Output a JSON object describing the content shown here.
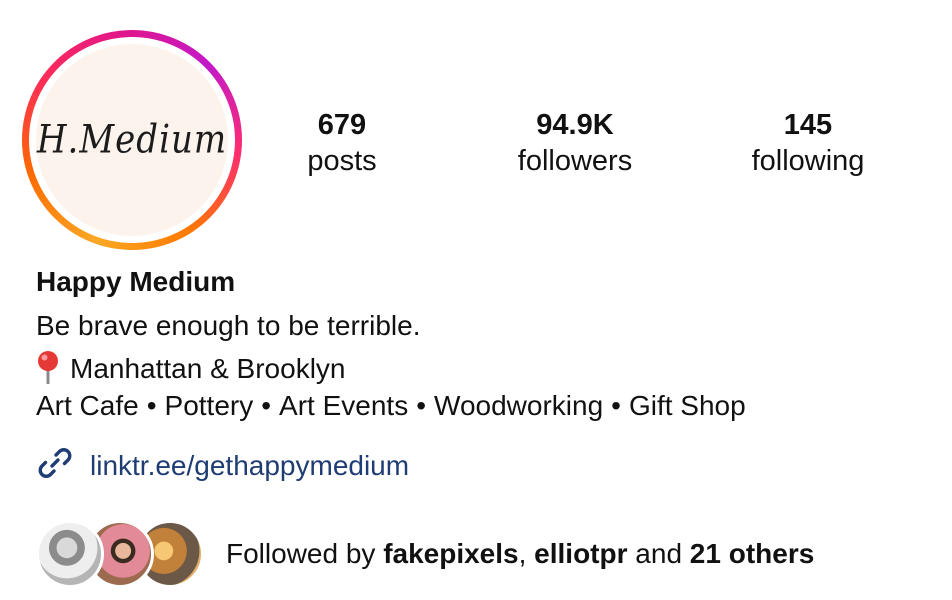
{
  "profile": {
    "logo_text": "H.Medium",
    "name": "Happy Medium",
    "stats": [
      {
        "value": "679",
        "label": "posts"
      },
      {
        "value": "94.9K",
        "label": "followers"
      },
      {
        "value": "145",
        "label": "following"
      }
    ],
    "bio": {
      "line1": "Be brave enough to be terrible.",
      "location": "Manhattan & Brooklyn",
      "categories": [
        "Art Cafe",
        "Pottery",
        "Art Events",
        "Woodworking",
        "Gift Shop"
      ],
      "separator": "•"
    },
    "link": "linktr.ee/gethappymedium",
    "followed_by": {
      "prefix": "Followed by",
      "user1": "fakepixels",
      "comma": ",",
      "user2": "elliotpr",
      "and": "and",
      "others": "21 others"
    }
  },
  "colors": {
    "link": "#1f3c73",
    "pin": "#e53935",
    "text": "#111111"
  },
  "icons": {
    "location": "pin-icon",
    "link": "link-icon"
  }
}
